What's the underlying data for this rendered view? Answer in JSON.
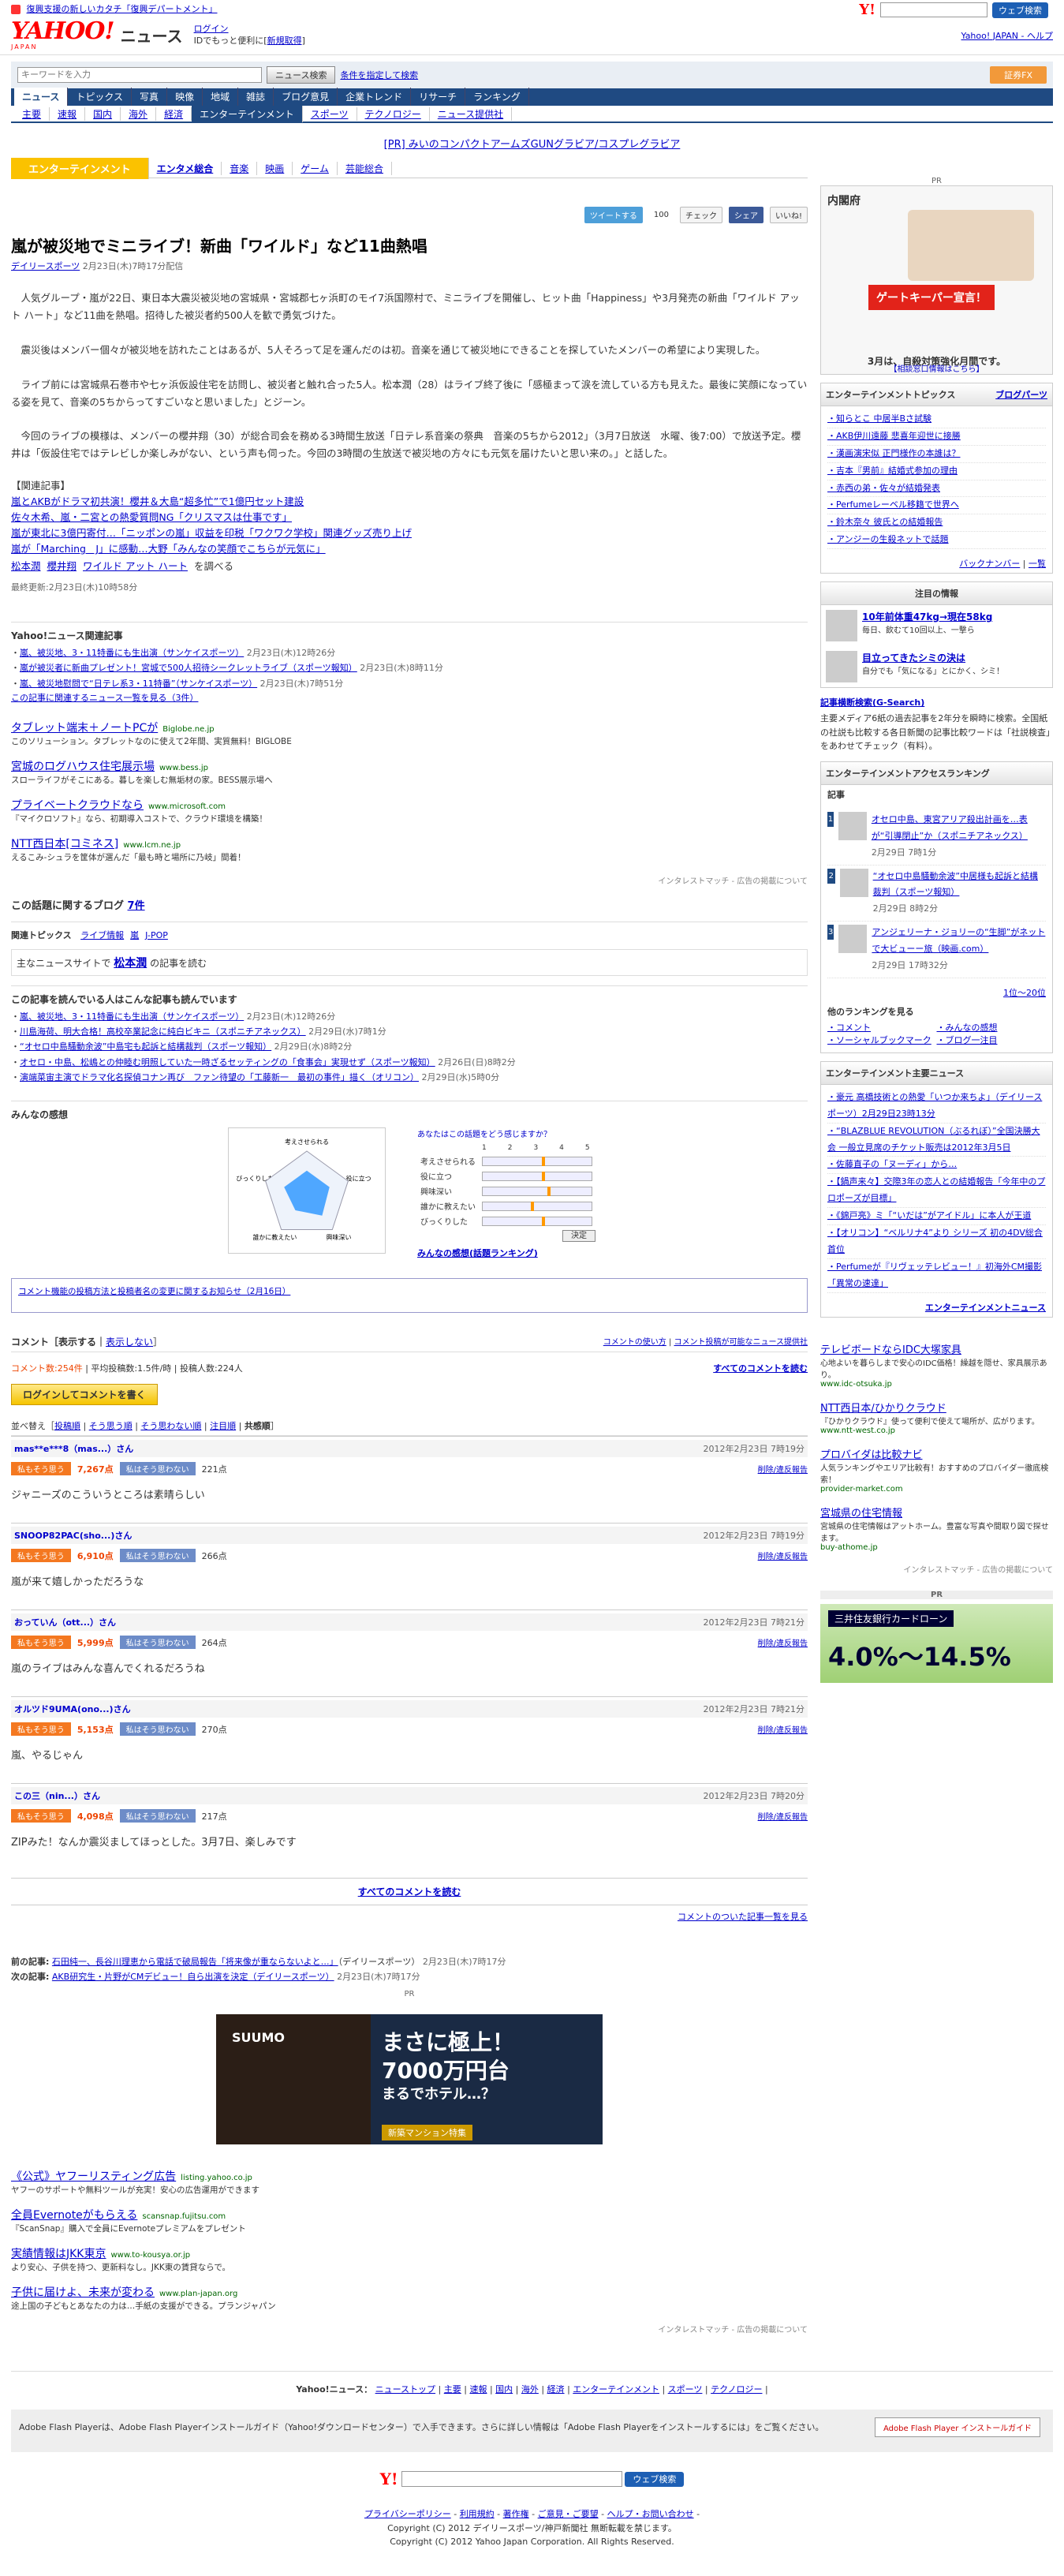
{
  "top": {
    "promo": "復興支援の新しいカタチ「復興デパートメント」",
    "search_button": "ウェブ検索"
  },
  "header": {
    "logo": "YAHOO!",
    "logo_sub": "JAPAN",
    "news_label": "ニュース",
    "login": "ログイン",
    "login_sub": "IDでもっと便利に[",
    "signup": "新規取得",
    "links": "Yahoo! JAPAN - ヘルプ"
  },
  "search": {
    "placeholder": "キーワードを入力",
    "button": "ニュース検索",
    "condition": "条件を指定して検索",
    "ad": "証券FX"
  },
  "tabs": [
    "ニュース",
    "トピックス",
    "写真",
    "映像",
    "地域",
    "雑誌",
    "ブログ意見",
    "企業トレンド",
    "リサーチ",
    "ランキング"
  ],
  "subtabs": [
    "主要",
    "速報",
    "国内",
    "海外",
    "経済",
    "エンターテインメント",
    "スポーツ",
    "テクノロジー",
    "ニュース提供社"
  ],
  "pr_line": "[PR] みいのコンパクトアームズGUNグラビア/コスプレグラビア",
  "category": {
    "label": "エンターテインメント",
    "items": [
      "エンタメ総合",
      "音楽",
      "映画",
      "ゲーム",
      "芸能総合"
    ]
  },
  "social": {
    "tweet": "ツイートする",
    "tweet_count": "100",
    "check": "チェック",
    "share": "シェア",
    "like": "いいね!"
  },
  "article": {
    "title": "嵐が被災地でミニライブ！新曲「ワイルド」など11曲熱唱",
    "source": "デイリースポーツ",
    "date": "2月23日(木)7時17分配信",
    "paragraphs": [
      "人気グループ・嵐が22日、東日本大震災被災地の宮城県・宮城郡七ヶ浜町のモイ7浜国際村で、ミニライブを開催し、ヒット曲「Happiness」や3月発売の新曲「ワイルド アット ハート」など11曲を熱唱。招待した被災者約500人を歓で勇気づけた。",
      "震災後はメンバー個々が被災地を訪れたことはあるが、5人そろって足を運んだのは初。音楽を通じて被災地にできることを探していたメンバーの希望により実現した。",
      "ライブ前には宮城県石巻市や七ヶ浜仮設住宅を訪問し、被災者と触れ合った5人。松本潤（28）はライブ終了後に「感極まって涙を流している方も見えた。最後に笑顔になっている姿を見て、音楽の5ちからってすごいなと思いました」とジーン。",
      "今回のライブの模様は、メンバーの櫻井翔（30）が総合司会を務める3時間生放送「日テレ系音楽の祭典　音楽の5ちから2012」（3月7日放送　水曜、後7:00）で放送予定。櫻井は「仮設住宅ではテレビしか楽しみがない、という声も伺った。今回の3時間の生放送で被災地の方々にも元気を届けたいと思い来の。」と話した。"
    ],
    "related_heading": "【関連記事】",
    "related": [
      "嵐とAKBがドラマ初共演！櫻井＆大島“超多忙”で1億円セット建設",
      "佐々木希、嵐・二宮との熱愛質問NG「クリスマスは仕事です」",
      "嵐が東北に3億円寄付…「ニッポンの嵐」収益を印税「ワクワク学校」関連グッズ売り上げ",
      "嵐が「Marching　J」に感動…大野「みんなの笑顔でこちらが元気に」"
    ],
    "keywords": [
      "松本潤",
      "櫻井翔",
      "ワイルド アット ハート"
    ],
    "kw_suffix": "を調べる",
    "updated": "最終更新:2月23日(木)10時58分",
    "daily_logo": "デイリースポーツ"
  },
  "yahoo_related": {
    "title": "Yahoo!ニュース関連記事",
    "items": [
      {
        "t": "嵐、被災地、3・11特番にも生出演",
        "s": "（サンケイスポーツ）",
        "d": "2月23日(木)12時26分"
      },
      {
        "t": "嵐が被災者に新曲プレゼント！宮城で500人招待シークレットライブ",
        "s": "（スポーツ報知）",
        "d": "2月23日(木)8時11分"
      },
      {
        "t": "嵐、被災地慰問で“日テレ系3・11特番”",
        "s": "（サンケイスポーツ）",
        "d": "2月23日(木)7時51分"
      }
    ],
    "more": "この記事に関連するニュース一覧を見る（3件）"
  },
  "ads1": [
    {
      "t": "タブレット端末＋ノートPCが",
      "u": "Biglobe.ne.jp",
      "d": "このソリューション。タブレットなのに使えて2年間、実質無料！BIGLOBE"
    },
    {
      "t": "宮城のログハウス住宅展示場",
      "u": "www.bess.jp",
      "d": "スローライフがそこにある。暮しを楽しむ無垢材の家。BESS展示場へ"
    },
    {
      "t": "プライベートクラウドなら",
      "u": "www.microsoft.com",
      "d": "『マイクロソフト』なら、初期導入コストで、クラウド環境を構築！"
    },
    {
      "t": "NTT西日本[コミネス]",
      "u": "www.lcm.ne.jp",
      "d": "えるこみ-シュラを筐体が選んだ「最も時と場所に乃岐」間着！"
    }
  ],
  "ad_note": "インタレストマッチ - 広告の掲載について",
  "blog": {
    "label": "この話題に関するブログ",
    "count": "7件"
  },
  "topics": {
    "label": "関連トピックス",
    "items": [
      "ライブ情報",
      "嵐",
      "J-POP"
    ]
  },
  "person": {
    "pre": "主なニュースサイトで",
    "name": "松本潤",
    "post": "の記事を読む"
  },
  "readers": {
    "title": "この記事を読んでいる人はこんな記事も読んでいます",
    "items": [
      {
        "t": "嵐、被災地、3・11特番にも生出演",
        "s": "（サンケイスポーツ）",
        "d": "2月23日(木)12時26分"
      },
      {
        "t": "川島海荷、明大合格！高校卒業記念に純白ビキニ",
        "s": "（スポニチアネックス）",
        "d": "2月29日(水)7時1分"
      },
      {
        "t": "“オセロ中島騒動余波”中島宅も起訴と結構裁判",
        "s": "（スポーツ報知）",
        "d": "2月29日(水)8時2分"
      },
      {
        "t": "オセロ・中島、松嶋との仲睦む明照していた一時ざるセッティングの「食事会」実現せず",
        "s": "（スポーツ報知）",
        "d": "2月26日(日)8時2分"
      },
      {
        "t": "演端菜宙主演でドラマ化名探偵コナン再び　ファン待望の「工藤新一　最初の事件」描く",
        "s": "（オリコン）",
        "d": "2月29日(水)5時0分"
      }
    ]
  },
  "minna": {
    "title": "みんなの感想",
    "q": "あなたはこの話題を",
    "q2": "どう感じますか？",
    "axes": [
      "考えさせられる",
      "役に立つ",
      "興味深い",
      "誰かに教えたい",
      "びっくりした"
    ],
    "scale": [
      "1",
      "2",
      "3",
      "4",
      "5"
    ],
    "levels": [
      0.55,
      0.55,
      0.6,
      0.45,
      0.55
    ],
    "decide": "決定",
    "ranking": "みんなの感想(話題ランキング)"
  },
  "notice": "コメント機能の投稿方法と投稿者名の変更に関するお知らせ（2月16日）",
  "comments_hdr": {
    "label": "コメント［表示する｜",
    "hide": "表示しない",
    "hide_end": "］",
    "howto": "コメントの使い方",
    "possible": "コメント投稿が可能なニュース提供社"
  },
  "cmt_stat": {
    "count": "コメント数:254件",
    "avg": "平均投稿数:1.5件/時",
    "users": "投稿人数:224人",
    "read_all": "すべてのコメントを読む"
  },
  "login_btn": "ログインしてコメントを書く",
  "sort": {
    "label": "並べ替え［",
    "items": [
      "投稿順",
      "そう思う順",
      "そう思わない順",
      "注目順"
    ],
    "active": "共感順",
    "end": "］"
  },
  "vote_yes": "私もそう思う",
  "vote_no": "私はそう思わない",
  "report": "削除/違反報告",
  "comments": [
    {
      "n": "mas**e***8（mas...）さん",
      "d": "2012年2月23日 7時19分",
      "y": "7,267点",
      "no": "221点",
      "t": "ジャニーズのこういうところは素晴らしい"
    },
    {
      "n": "SNOOP82PAC(sho...)さん",
      "d": "2012年2月23日 7時19分",
      "y": "6,910点",
      "no": "266点",
      "t": "嵐が来て嬉しかっただろうな"
    },
    {
      "n": "おっていん（ott...）さん",
      "d": "2012年2月23日 7時21分",
      "y": "5,999点",
      "no": "264点",
      "t": "嵐のライブはみんな喜んでくれるだろうね"
    },
    {
      "n": "オルツド9UMA(ono...)さん",
      "d": "2012年2月23日 7時21分",
      "y": "5,153点",
      "no": "270点",
      "t": "嵐、やるじゃん"
    },
    {
      "n": "この三（nin...）さん",
      "d": "2012年2月23日 7時20分",
      "y": "4,098点",
      "no": "217点",
      "t": "ZIPみた！なんか震災ましてほっとした。3月7日、楽しみです"
    }
  ],
  "read_all2": "すべてのコメントを読む",
  "cmt_article": "コメントのついた記事一覧を見る",
  "prevnext": {
    "prev_label": "前の記事:",
    "prev": "石田純一、長谷川理恵から電話で破局報告「将来像が重ならないよと…」",
    "prev_src": "（デイリースポーツ）",
    "prev_d": "2月23日(木)7時17分",
    "next_label": "次の記事:",
    "next": "AKB研究生・片野がCMデビュー！自ら出演を決定（デイリースポーツ）",
    "next_src": "",
    "next_d": "2月23日(木)7時17分"
  },
  "pr_label": "PR",
  "banner": {
    "brand": "SUUMO",
    "line1": "まさに極上！",
    "line2": "7000万円台",
    "line3": "まるでホテル…？",
    "cta": "新築マンション特集"
  },
  "ads2": [
    {
      "t": "《公式》ヤフーリスティング広告",
      "u": "listing.yahoo.co.jp",
      "d": "ヤフーのサポートや無料ツールが充実！安心の広告運用ができます"
    },
    {
      "t": "全員Evernoteがもらえる",
      "u": "scansnap.fujitsu.com",
      "d": "『ScanSnap』購入で全員にEvernoteプレミアムをプレゼント"
    },
    {
      "t": "実績情報はJKK東京",
      "u": "www.to-kousya.or.jp",
      "d": "より安心、子供を持つ、更新料なし。JKK東の賃貸ならで。"
    },
    {
      "t": "子供に届けよ、未来が変わる",
      "u": "www.plan-japan.org",
      "d": "途上国の子どもとあなたの力は…手紙の支援ができる。プランジャパン"
    }
  ],
  "footer_links": [
    "ニューストップ",
    "主要",
    "速報",
    "国内",
    "海外",
    "経済",
    "エンターテインメント",
    "スポーツ",
    "テクノロジー"
  ],
  "footer_label": "Yahoo!ニュース：",
  "flash": {
    "text": "Adobe Flash Playerは、Adobe Flash Playerインストールガイド（Yahoo!ダウンロードセンター）で入手できます。さらに詳しい情報は「Adobe Flash Playerをインストールするには」をご覧ください。",
    "btn": "Adobe Flash Player インストールガイド"
  },
  "bottom_links": [
    "プライバシーポリシー",
    "利用規約",
    "著作権",
    "ご意見・ご要望",
    "ヘルプ・お問い合わせ"
  ],
  "copyright1": "Copyright (C) 2012 デイリースポーツ/神戸新聞社 無断転載を禁じます。",
  "copyright2": "Copyright (C) 2012 Yahoo Japan Corporation. All Rights Reserved.",
  "side": {
    "pr": "PR",
    "cabinet_title": "内閣府",
    "cabinet_band": "ゲートキーパー宣言！",
    "cabinet_cap": "3月は、自殺対策強化月間です。",
    "cabinet_cap2": "【相談窓口情報はこちら】",
    "topics_title": "エンターテインメントトピックス",
    "topics_more": "ブログパーツ",
    "topics": [
      "知らとこ 中居半Bさ試験",
      "AKB伊川遠藤 悲喜年迎世に接勝",
      "漢画演宋似 正門様作の本誰は？",
      "吉本『男前』結婚式参加の理由",
      "赤西の弟・佐々が結婚発表",
      "Perfumeレーベル移籍で世界へ",
      "鈴木奈々 彼氏との結婚報告",
      "アンジーの生殺ネットで話題"
    ],
    "backnum": "バックナンバー",
    "all": "一覧",
    "attention": "注目の情報",
    "att1": "10年前体重47kg→現在58kg",
    "att1d": "毎日、飲むて10回以上、一撃ら",
    "att2": "目立ってきたシミの決は",
    "att2d": "自分でも「気になる」とにかく、シミ！",
    "g_title": "記事横断検索(G-Search)",
    "g_text": "主要メディア6紙の過去記事を2年分を瞬時に検索。全国紙の社説も比較する各日新聞の記事比較ワードは「社説検査」をあわせてチェック（有料）。",
    "rank_title": "エンターテインメントアクセスランキング",
    "rank_sub": "記事",
    "rank": [
      {
        "t": "オセロ中島、東宮アリア殺出計画を…表が“引導閉止”か（スポニチアネックス）",
        "d": "2月29日 7時1分"
      },
      {
        "t": "“オセロ中島騒動余波”中居様も起訴と結構裁判（スポーツ報知）",
        "d": "2月29日 8時2分"
      },
      {
        "t": "アンジェリーナ・ジョリーの“生脚”がネットで大ビューー旅（映画.com）",
        "d": "2月29日 17時32分"
      }
    ],
    "rank_more": "1位～20位",
    "other": "他のランキングを見る",
    "other_links": [
      "コメント",
      "みんなの感想",
      "ソーシャルブックマーク",
      "ブログ一注目"
    ],
    "main_title": "エンターテインメント主要ニュース",
    "main_news": [
      "豪元 高橋技術との熱愛「いつか来ちよ」（デイリースポーツ）2月29日23時13分",
      "“BLAZBLUE REVOLUTION（ぶるれぼ）”全国決勝大会 一般立見席のチケット販売は2012年3月5日",
      "佐藤直子の「ヌーディ」から…",
      "【鍋声来々】交際3年の恋人との結婚報告「今年中のプロポーズが目標」",
      "《錦戸亮》ミ「“いだは”がアイドル」に本人が王道",
      "【オリコン】“ベルリナ4”より シリーズ 初の4DV総合首位",
      "Perfumeが『リヴェッテレビュー！』初海外CM撮影「異常の速達」"
    ],
    "main_more": "エンターテインメントニュース",
    "ads": [
      {
        "t": "テレビボードならIDC大塚家具",
        "d": "心地よいを暮らしまで安心のIDC価格！繰越を隠せ、家具展示あり。",
        "u": "www.idc-otsuka.jp"
      },
      {
        "t": "NTT西日本/ひかりクラウド",
        "d": "『ひかりクラウド』使って便利で使えて場所が、広がります。",
        "u": "www.ntt-west.co.jp"
      },
      {
        "t": "プロバイダは比較ナビ",
        "d": "人気ランキングやエリア比較有！おすすめのプロバイダー徹底検索！",
        "u": "provider-market.com"
      },
      {
        "t": "宮城県の住宅情報",
        "d": "宮城県の住宅情報はアットホーム。豊富な写真や間取り図で探せます。",
        "u": "buy-athome.jp"
      }
    ],
    "pr2": "PR",
    "mitsui": "三井住友銀行カードローン",
    "mitsui_rate": "4.0%～14.5%"
  }
}
